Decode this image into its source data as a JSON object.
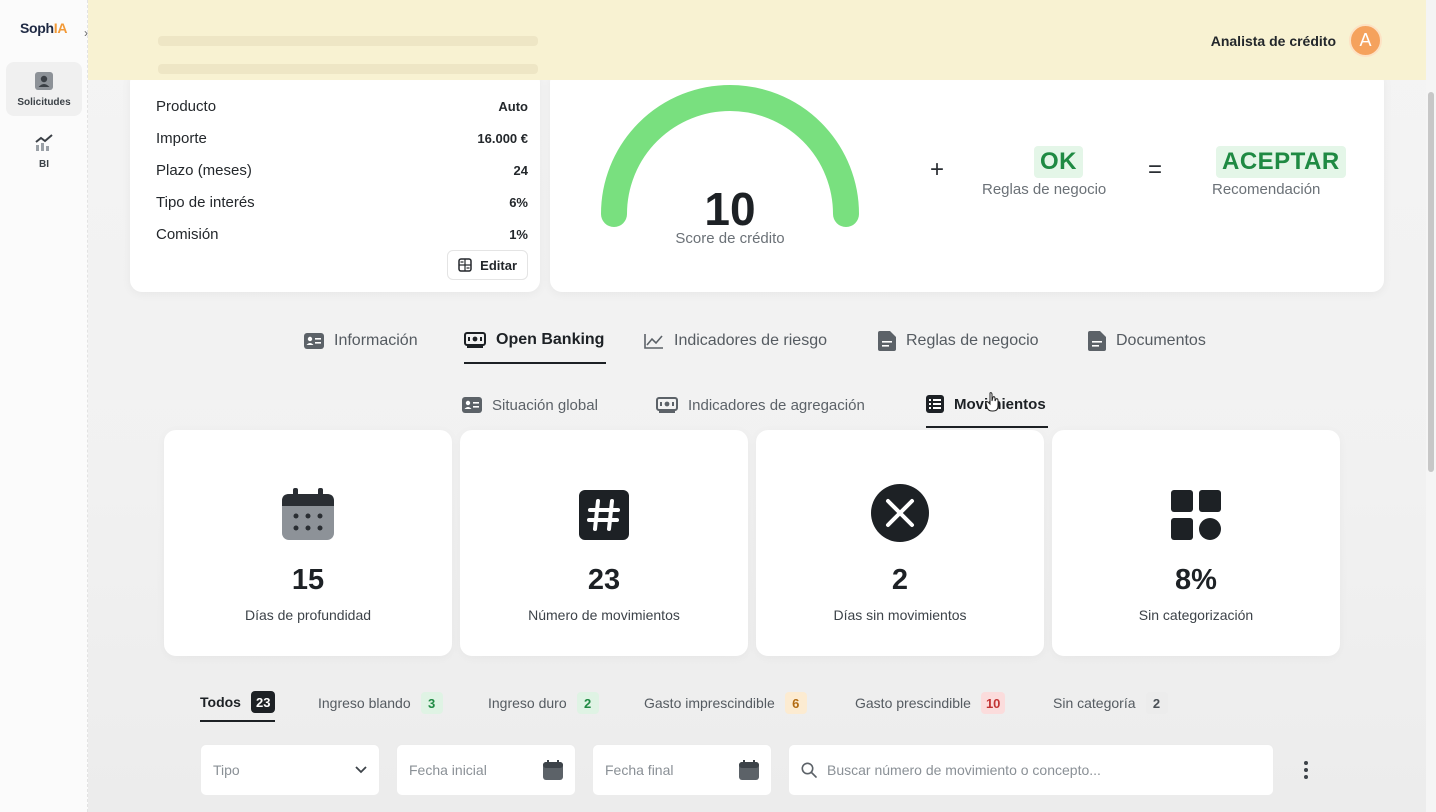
{
  "sidebar": {
    "logo_text": "Soph",
    "logo_accent": "IA",
    "items": [
      {
        "label": "Solicitudes",
        "icon": "user-card-icon",
        "active": true
      },
      {
        "label": "BI",
        "icon": "chart-trend-icon",
        "active": false
      }
    ]
  },
  "header": {
    "role": "Analista de crédito",
    "avatar_initial": "A",
    "background": "#f8f2d2"
  },
  "loan": {
    "rows": [
      {
        "label": "Producto",
        "value": "Auto"
      },
      {
        "label": "Importe",
        "value": "16.000 €"
      },
      {
        "label": "Plazo (meses)",
        "value": "24"
      },
      {
        "label": "Tipo de interés",
        "value": "6%"
      },
      {
        "label": "Comisión",
        "value": "1%"
      }
    ],
    "edit_label": "Editar"
  },
  "score": {
    "value": "10",
    "label": "Score de crédito",
    "gauge_color": "#79e07f",
    "plus": "+",
    "rules_value": "OK",
    "rules_label": "Reglas de negocio",
    "equals": "=",
    "recommendation_value": "ACEPTAR",
    "recommendation_label": "Recomendación"
  },
  "main_tabs": [
    {
      "label": "Información",
      "icon": "id-card-icon",
      "active": false
    },
    {
      "label": "Open Banking",
      "icon": "banknote-icon",
      "active": true
    },
    {
      "label": "Indicadores de riesgo",
      "icon": "line-chart-icon",
      "active": false
    },
    {
      "label": "Reglas de negocio",
      "icon": "document-icon",
      "active": false
    },
    {
      "label": "Documentos",
      "icon": "documents-icon",
      "active": false
    }
  ],
  "sub_tabs": [
    {
      "label": "Situación global",
      "icon": "id-card-icon",
      "active": false
    },
    {
      "label": "Indicadores de agregación",
      "icon": "banknote-icon",
      "active": false
    },
    {
      "label": "Movimientos",
      "icon": "list-icon",
      "active": true
    }
  ],
  "stats": [
    {
      "value": "15",
      "label": "Días de profundidad",
      "icon": "calendar-icon"
    },
    {
      "value": "23",
      "label": "Número de movimientos",
      "icon": "hash-icon"
    },
    {
      "value": "2",
      "label": "Días sin movimientos",
      "icon": "x-circle-icon"
    },
    {
      "value": "8%",
      "label": "Sin categorización",
      "icon": "categories-icon"
    }
  ],
  "filters": [
    {
      "label": "Todos",
      "count": "23",
      "style": "dark",
      "active": true
    },
    {
      "label": "Ingreso blando",
      "count": "3",
      "style": "green",
      "active": false
    },
    {
      "label": "Ingreso duro",
      "count": "2",
      "style": "green",
      "active": false
    },
    {
      "label": "Gasto imprescindible",
      "count": "6",
      "style": "orange",
      "active": false
    },
    {
      "label": "Gasto prescindible",
      "count": "10",
      "style": "red",
      "active": false
    },
    {
      "label": "Sin categoría",
      "count": "2",
      "style": "gray",
      "active": false
    }
  ],
  "inputs": {
    "type_placeholder": "Tipo",
    "start_date_placeholder": "Fecha inicial",
    "end_date_placeholder": "Fecha final",
    "search_placeholder": "Buscar número de movimiento o concepto..."
  }
}
